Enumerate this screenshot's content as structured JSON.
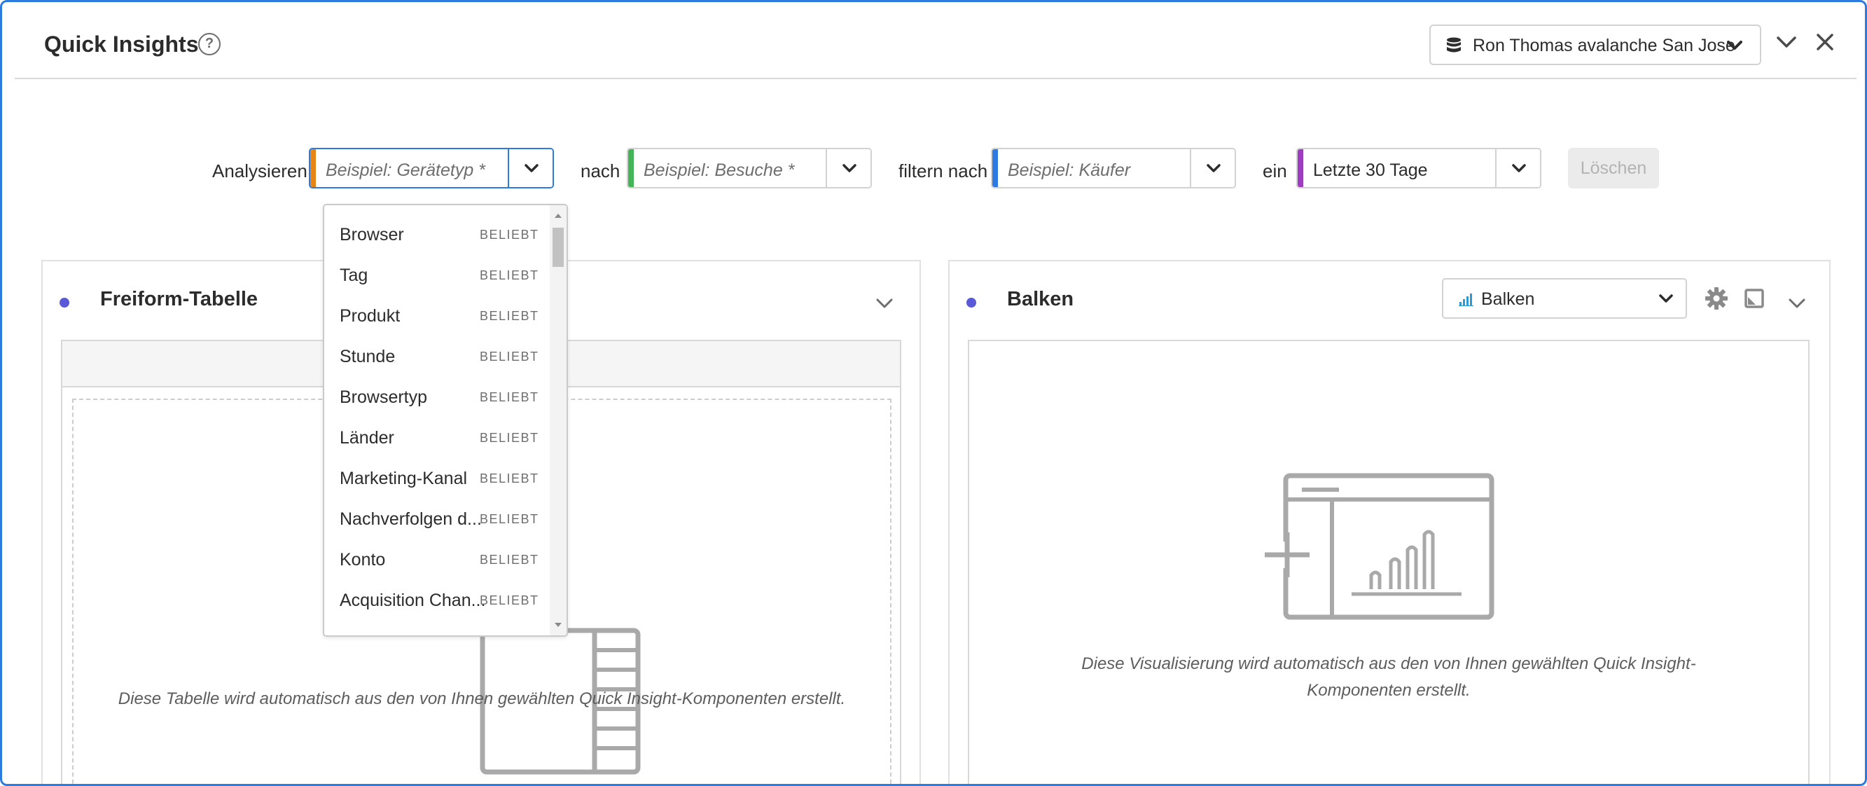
{
  "header": {
    "title": "Quick Insights",
    "help_icon": "help-icon",
    "report_suite": {
      "icon": "database-icon",
      "label": "Ron Thomas avalanche San Jose"
    },
    "collapse_icon": "chevron-down-icon",
    "close_icon": "close-icon"
  },
  "query": {
    "analyze_label": "Analysieren",
    "analyze_placeholder": "Beispiel: Gerätetyp *",
    "by_label": "nach",
    "by_placeholder": "Beispiel: Besuche *",
    "filter_label": "filtern nach",
    "filter_placeholder": "Beispiel: Käufer",
    "in_label": "ein",
    "date_value": "Letzte 30 Tage",
    "clear_label": "Löschen",
    "colors": {
      "analyze": "#e68619",
      "by": "#44b556",
      "filter": "#2d7be0",
      "date": "#9d3dbf"
    }
  },
  "dropdown": {
    "items": [
      {
        "label": "Browser",
        "badge": "BELIEBT"
      },
      {
        "label": "Tag",
        "badge": "BELIEBT"
      },
      {
        "label": "Produkt",
        "badge": "BELIEBT"
      },
      {
        "label": "Stunde",
        "badge": "BELIEBT"
      },
      {
        "label": "Browsertyp",
        "badge": "BELIEBT"
      },
      {
        "label": "Länder",
        "badge": "BELIEBT"
      },
      {
        "label": "Marketing-Kanal",
        "badge": "BELIEBT"
      },
      {
        "label": "Nachverfolgen d...",
        "badge": "BELIEBT"
      },
      {
        "label": "Konto",
        "badge": "BELIEBT"
      },
      {
        "label": "Acquisition Chan...",
        "badge": "BELIEBT"
      }
    ]
  },
  "panels": {
    "left": {
      "title": "Freiform-Tabelle",
      "caption": "Diese Tabelle wird automatisch aus den von Ihnen gewählten Quick Insight-Komponenten erstellt."
    },
    "right": {
      "title": "Balken",
      "viz_type": "Balken",
      "caption_line1": "Diese Visualisierung wird automatisch aus den von Ihnen gewählten Quick Insight-",
      "caption_line2": "Komponenten erstellt."
    }
  }
}
